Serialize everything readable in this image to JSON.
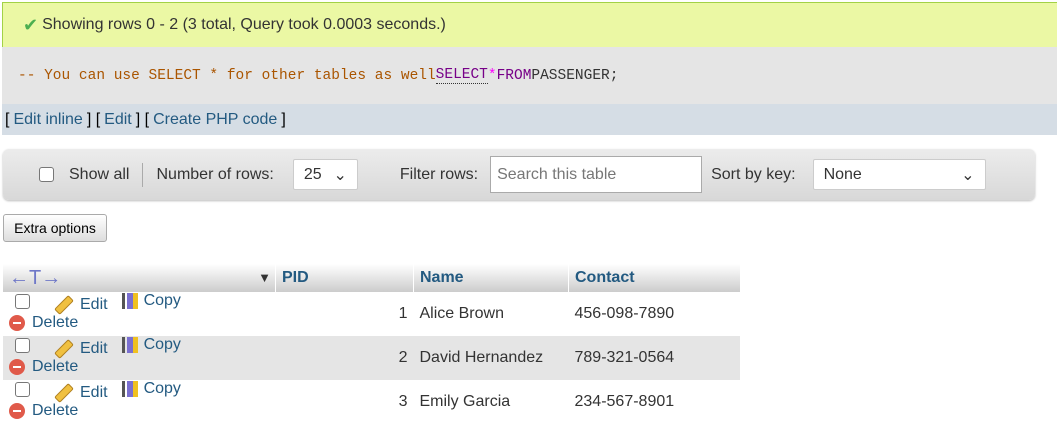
{
  "message": "Showing rows 0 - 2 (3 total, Query took 0.0003 seconds.)",
  "sql": {
    "comment": "-- You can use SELECT * for other tables as well",
    "kw1": "SELECT",
    "star": "*",
    "kw2": "FROM",
    "table": "PASSENGER;"
  },
  "links": [
    "Edit inline",
    "Edit",
    "Create PHP code"
  ],
  "nav": {
    "show_all": "Show all",
    "rows_label": "Number of rows:",
    "rows_value": "25",
    "filter_label": "Filter rows:",
    "filter_placeholder": "Search this table",
    "sort_label": "Sort by key:",
    "sort_value": "None"
  },
  "extra_options": "Extra options",
  "table": {
    "arrows": "←T→",
    "columns": [
      "PID",
      "Name",
      "Contact"
    ],
    "actions": {
      "edit": "Edit",
      "copy": "Copy",
      "delete": "Delete"
    },
    "rows": [
      {
        "pid": "1",
        "name": "Alice Brown",
        "contact": "456-098-7890"
      },
      {
        "pid": "2",
        "name": "David Hernandez",
        "contact": "789-321-0564"
      },
      {
        "pid": "3",
        "name": "Emily Garcia",
        "contact": "234-567-8901"
      }
    ]
  }
}
